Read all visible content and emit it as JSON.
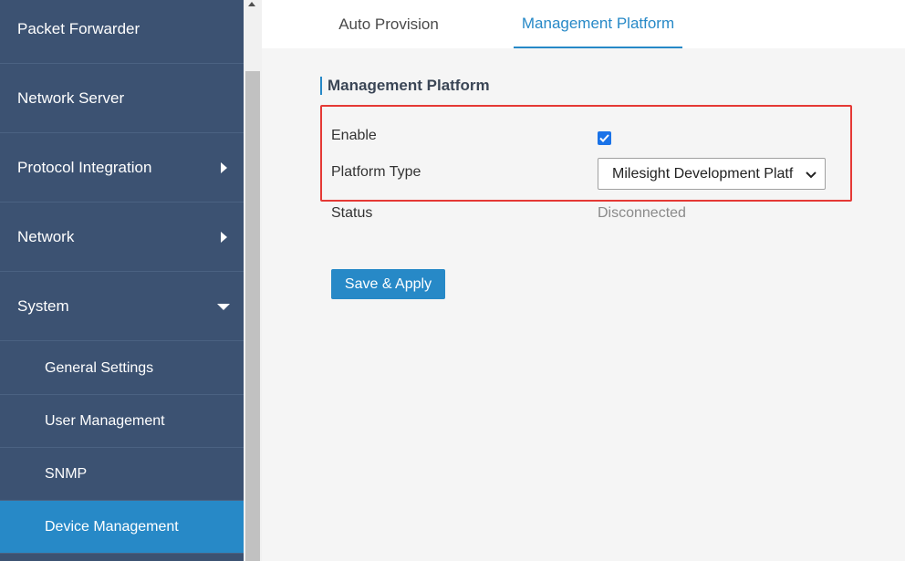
{
  "sidebar": {
    "items": [
      {
        "label": "Packet Forwarder",
        "arrow": "none"
      },
      {
        "label": "Network Server",
        "arrow": "none"
      },
      {
        "label": "Protocol Integration",
        "arrow": "right"
      },
      {
        "label": "Network",
        "arrow": "right"
      },
      {
        "label": "System",
        "arrow": "down"
      }
    ],
    "subitems": [
      {
        "label": "General Settings"
      },
      {
        "label": "User Management"
      },
      {
        "label": "SNMP"
      },
      {
        "label": "Device Management",
        "active": true
      }
    ]
  },
  "tabs": [
    {
      "label": "Auto Provision"
    },
    {
      "label": "Management Platform",
      "active": true
    }
  ],
  "form": {
    "section_title": "Management Platform",
    "enable_label": "Enable",
    "enable_checked": true,
    "platform_type_label": "Platform Type",
    "platform_type_value": "Milesight Development Platf",
    "status_label": "Status",
    "status_value": "Disconnected",
    "save_label": "Save & Apply"
  },
  "colors": {
    "sidebar_bg": "#3c5272",
    "accent": "#2789c7",
    "highlight_box": "#e53935"
  }
}
